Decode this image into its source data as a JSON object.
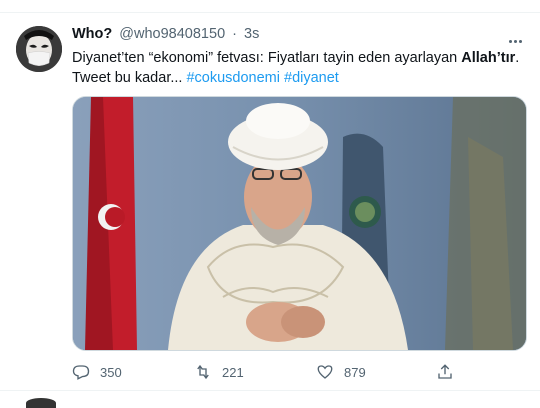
{
  "tweet": {
    "display_name": "Who?",
    "handle": "@who98408150",
    "separator": "·",
    "time": "3s",
    "text": {
      "part1": "Diyanet’ten “ekonomi” fetvası: Fiyatları tayin eden ayarlayan ",
      "bold": "Allah’tır",
      "part2": ".",
      "line2": "Tweet bu kadar... ",
      "hashtag1": "#cokusdonemi",
      "hashtag2": "#diyanet"
    },
    "media": {
      "description_icon": "photo-icon"
    },
    "actions": {
      "reply_count": "350",
      "retweet_count": "221",
      "like_count": "879"
    }
  },
  "colors": {
    "accent": "#1d9bf0",
    "text": "#0f1419",
    "muted": "#536471",
    "border": "#eff3f4"
  }
}
